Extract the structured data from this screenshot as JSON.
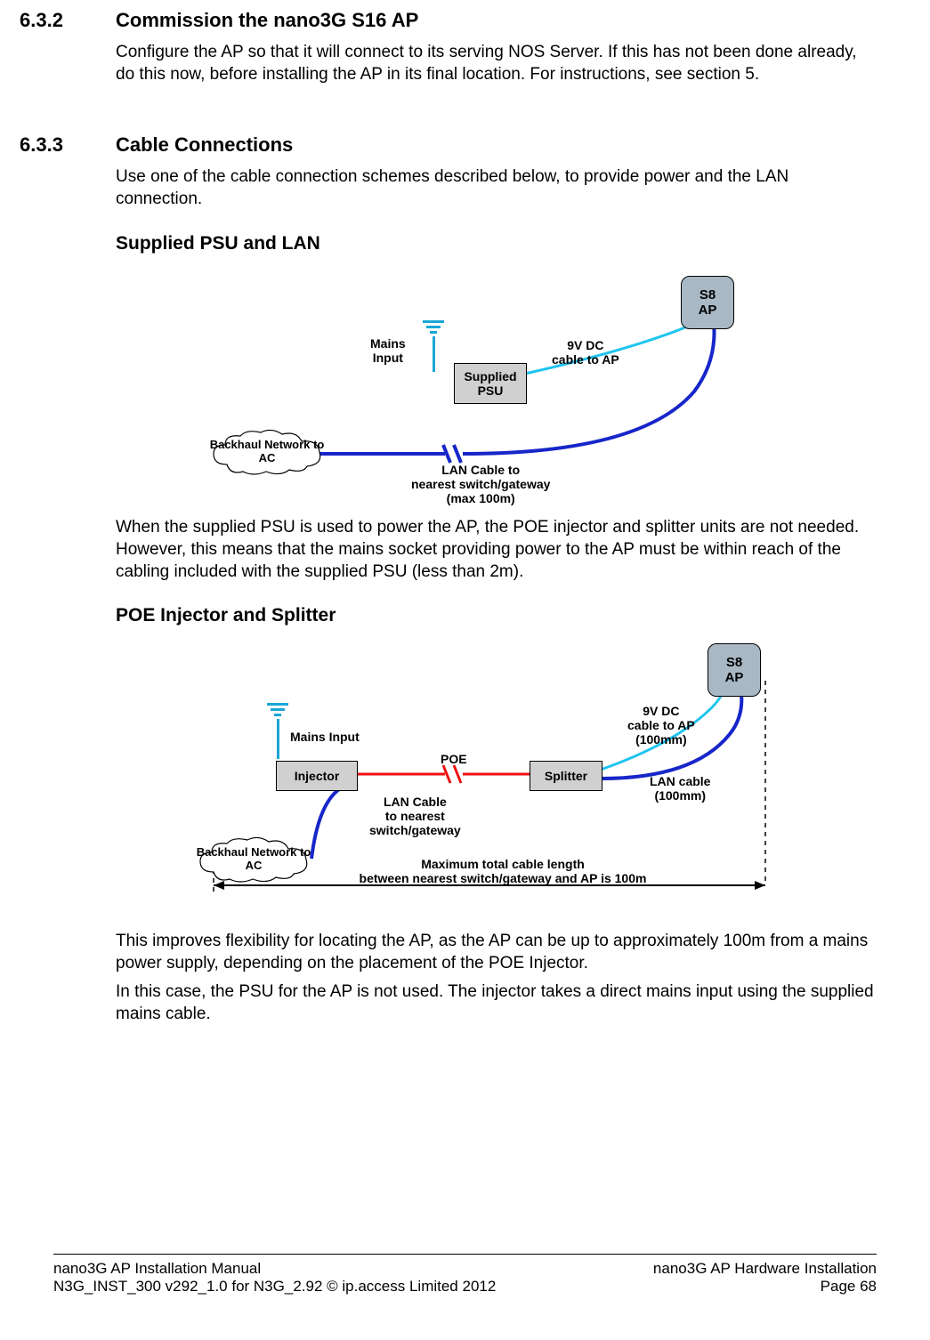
{
  "sections": {
    "s632": {
      "num": "6.3.2",
      "title": "Commission the nano3G S16 AP",
      "body": "Configure the AP so that it will connect to its serving NOS Server. If this has not been done already, do this now, before installing the AP in its final location. For instructions, see section 5."
    },
    "s633": {
      "num": "6.3.3",
      "title": "Cable Connections",
      "body": "Use one of the cable connection schemes described below, to provide power and the LAN connection."
    },
    "psu": {
      "title": "Supplied PSU and LAN",
      "body": "When the supplied PSU is used to power the AP, the POE injector and splitter units are not needed. However, this means that the mains socket providing power to the AP must be within reach of the cabling included with the supplied PSU (less than 2m)."
    },
    "poe": {
      "title": "POE Injector and Splitter",
      "body1": "This improves flexibility for locating the AP, as the AP can be up to approximately 100m from a mains power supply, depending on the placement of the POE Injector.",
      "body2": "In this case, the PSU for the AP is not used. The injector takes a direct mains input using the supplied mains cable."
    }
  },
  "diagram1": {
    "ap": "S8\nAP",
    "psu": "Supplied\nPSU",
    "mains": "Mains\nInput",
    "dc": "9V DC\ncable to AP",
    "cloud": "Backhaul\nNetwork to AC",
    "lan": "LAN Cable to\nnearest switch/gateway\n(max 100m)"
  },
  "diagram2": {
    "ap": "S8\nAP",
    "injector": "Injector",
    "splitter": "Splitter",
    "mains": "Mains Input",
    "poe": "POE",
    "dc": "9V DC\ncable to AP\n(100mm)",
    "lancable": "LAN cable\n(100mm)",
    "lan_near": "LAN Cable\nto nearest\nswitch/gateway",
    "cloud": "Backhaul\nNetwork to AC",
    "max": "Maximum total cable length\nbetween nearest switch/gateway and AP is 100m"
  },
  "footer": {
    "left1": "nano3G AP Installation Manual",
    "left2": "N3G_INST_300 v292_1.0 for N3G_2.92 © ip.access Limited 2012",
    "right1": "nano3G AP Hardware Installation",
    "right2": "Page 68"
  }
}
